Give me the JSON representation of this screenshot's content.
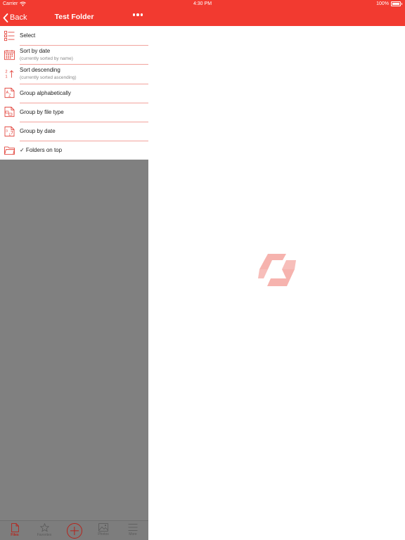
{
  "status_bar": {
    "carrier": "Carrier",
    "time": "4:30 PM",
    "battery": "100%"
  },
  "nav": {
    "back_label": "Back",
    "title": "Test Folder"
  },
  "menu": {
    "items": [
      {
        "label": "Select",
        "sub": "",
        "icon": "checklist-icon"
      },
      {
        "label": "Sort by date",
        "sub": "(currently sorted by name)",
        "icon": "calendar-icon"
      },
      {
        "label": "Sort descending",
        "sub": "(currently sorted ascending)",
        "icon": "sort-order-icon"
      },
      {
        "label": "Group alphabetically",
        "sub": "",
        "icon": "alphabet-doc-icon"
      },
      {
        "label": "Group by file type",
        "sub": "",
        "icon": "file-type-doc-icon"
      },
      {
        "label": "Group by date",
        "sub": "",
        "icon": "date-doc-icon"
      },
      {
        "label": "✓ Folders on top",
        "sub": "",
        "icon": "folder-icon"
      }
    ]
  },
  "tab_bar": {
    "tabs": [
      {
        "label": "Files",
        "icon": "file-icon"
      },
      {
        "label": "Favorites",
        "icon": "star-icon"
      },
      {
        "label": "Photos",
        "icon": "photo-icon"
      },
      {
        "label": "More",
        "icon": "menu-lines-icon"
      }
    ],
    "active_tab": "Files"
  },
  "colors": {
    "accent": "#f23a30",
    "accent_dark": "#b5241c",
    "dim_overlay": "#808080",
    "logo_tint": "#f6b3ae"
  }
}
